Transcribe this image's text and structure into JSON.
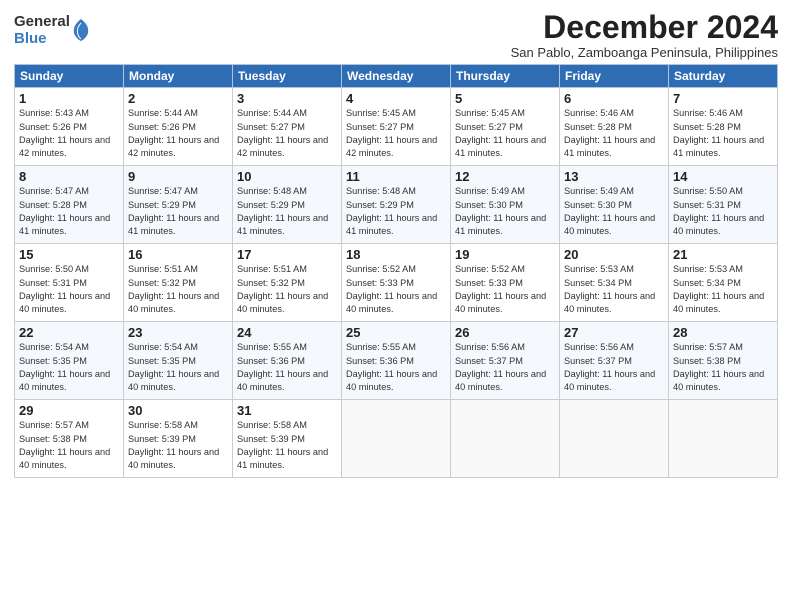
{
  "logo": {
    "general": "General",
    "blue": "Blue"
  },
  "title": "December 2024",
  "subtitle": "San Pablo, Zamboanga Peninsula, Philippines",
  "weekdays": [
    "Sunday",
    "Monday",
    "Tuesday",
    "Wednesday",
    "Thursday",
    "Friday",
    "Saturday"
  ],
  "weeks": [
    [
      {
        "day": 1,
        "sunrise": "5:43 AM",
        "sunset": "5:26 PM",
        "daylight": "11 hours and 42 minutes."
      },
      {
        "day": 2,
        "sunrise": "5:44 AM",
        "sunset": "5:26 PM",
        "daylight": "11 hours and 42 minutes."
      },
      {
        "day": 3,
        "sunrise": "5:44 AM",
        "sunset": "5:27 PM",
        "daylight": "11 hours and 42 minutes."
      },
      {
        "day": 4,
        "sunrise": "5:45 AM",
        "sunset": "5:27 PM",
        "daylight": "11 hours and 42 minutes."
      },
      {
        "day": 5,
        "sunrise": "5:45 AM",
        "sunset": "5:27 PM",
        "daylight": "11 hours and 41 minutes."
      },
      {
        "day": 6,
        "sunrise": "5:46 AM",
        "sunset": "5:28 PM",
        "daylight": "11 hours and 41 minutes."
      },
      {
        "day": 7,
        "sunrise": "5:46 AM",
        "sunset": "5:28 PM",
        "daylight": "11 hours and 41 minutes."
      }
    ],
    [
      {
        "day": 8,
        "sunrise": "5:47 AM",
        "sunset": "5:28 PM",
        "daylight": "11 hours and 41 minutes."
      },
      {
        "day": 9,
        "sunrise": "5:47 AM",
        "sunset": "5:29 PM",
        "daylight": "11 hours and 41 minutes."
      },
      {
        "day": 10,
        "sunrise": "5:48 AM",
        "sunset": "5:29 PM",
        "daylight": "11 hours and 41 minutes."
      },
      {
        "day": 11,
        "sunrise": "5:48 AM",
        "sunset": "5:29 PM",
        "daylight": "11 hours and 41 minutes."
      },
      {
        "day": 12,
        "sunrise": "5:49 AM",
        "sunset": "5:30 PM",
        "daylight": "11 hours and 41 minutes."
      },
      {
        "day": 13,
        "sunrise": "5:49 AM",
        "sunset": "5:30 PM",
        "daylight": "11 hours and 40 minutes."
      },
      {
        "day": 14,
        "sunrise": "5:50 AM",
        "sunset": "5:31 PM",
        "daylight": "11 hours and 40 minutes."
      }
    ],
    [
      {
        "day": 15,
        "sunrise": "5:50 AM",
        "sunset": "5:31 PM",
        "daylight": "11 hours and 40 minutes."
      },
      {
        "day": 16,
        "sunrise": "5:51 AM",
        "sunset": "5:32 PM",
        "daylight": "11 hours and 40 minutes."
      },
      {
        "day": 17,
        "sunrise": "5:51 AM",
        "sunset": "5:32 PM",
        "daylight": "11 hours and 40 minutes."
      },
      {
        "day": 18,
        "sunrise": "5:52 AM",
        "sunset": "5:33 PM",
        "daylight": "11 hours and 40 minutes."
      },
      {
        "day": 19,
        "sunrise": "5:52 AM",
        "sunset": "5:33 PM",
        "daylight": "11 hours and 40 minutes."
      },
      {
        "day": 20,
        "sunrise": "5:53 AM",
        "sunset": "5:34 PM",
        "daylight": "11 hours and 40 minutes."
      },
      {
        "day": 21,
        "sunrise": "5:53 AM",
        "sunset": "5:34 PM",
        "daylight": "11 hours and 40 minutes."
      }
    ],
    [
      {
        "day": 22,
        "sunrise": "5:54 AM",
        "sunset": "5:35 PM",
        "daylight": "11 hours and 40 minutes."
      },
      {
        "day": 23,
        "sunrise": "5:54 AM",
        "sunset": "5:35 PM",
        "daylight": "11 hours and 40 minutes."
      },
      {
        "day": 24,
        "sunrise": "5:55 AM",
        "sunset": "5:36 PM",
        "daylight": "11 hours and 40 minutes."
      },
      {
        "day": 25,
        "sunrise": "5:55 AM",
        "sunset": "5:36 PM",
        "daylight": "11 hours and 40 minutes."
      },
      {
        "day": 26,
        "sunrise": "5:56 AM",
        "sunset": "5:37 PM",
        "daylight": "11 hours and 40 minutes."
      },
      {
        "day": 27,
        "sunrise": "5:56 AM",
        "sunset": "5:37 PM",
        "daylight": "11 hours and 40 minutes."
      },
      {
        "day": 28,
        "sunrise": "5:57 AM",
        "sunset": "5:38 PM",
        "daylight": "11 hours and 40 minutes."
      }
    ],
    [
      {
        "day": 29,
        "sunrise": "5:57 AM",
        "sunset": "5:38 PM",
        "daylight": "11 hours and 40 minutes."
      },
      {
        "day": 30,
        "sunrise": "5:58 AM",
        "sunset": "5:39 PM",
        "daylight": "11 hours and 40 minutes."
      },
      {
        "day": 31,
        "sunrise": "5:58 AM",
        "sunset": "5:39 PM",
        "daylight": "11 hours and 41 minutes."
      },
      null,
      null,
      null,
      null
    ]
  ]
}
